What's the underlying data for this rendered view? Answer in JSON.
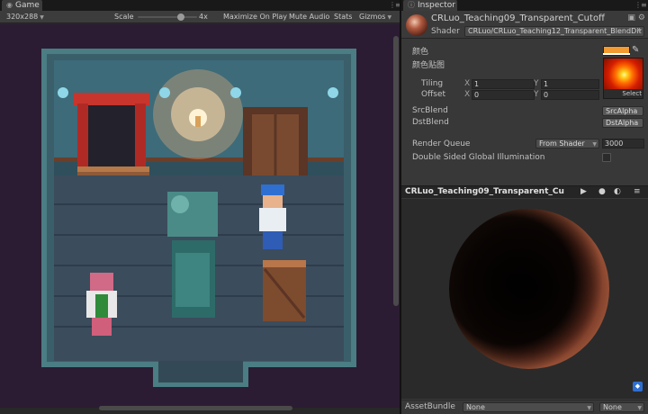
{
  "game": {
    "tab_label": "Game",
    "resolution": "320x288",
    "scale_label": "Scale",
    "scale_value": "4x",
    "scale_slider_fraction": 0.72,
    "maximize_label": "Maximize On Play",
    "mute_label": "Mute Audio",
    "stats_label": "Stats",
    "gizmos_label": "Gizmos"
  },
  "inspector": {
    "tab_label": "Inspector",
    "material_name": "CRLuo_Teaching09_Transparent_Cutoff",
    "shader_label": "Shader",
    "shader_value": "CRLuo/CRLuo_Teaching12_Transparent_BlendDit",
    "color_label": "颜色",
    "texture_label": "颜色贴图",
    "tiling_label": "Tiling",
    "offset_label": "Offset",
    "tiling_x": "1",
    "tiling_y": "1",
    "offset_x": "0",
    "offset_y": "0",
    "x_axis": "X",
    "y_axis": "Y",
    "select_label": "Select",
    "src_blend_label": "SrcBlend",
    "src_blend_value": "SrcAlpha",
    "dst_blend_label": "DstBlend",
    "dst_blend_value": "DstAlpha",
    "render_queue_label": "Render Queue",
    "render_queue_mode": "From Shader",
    "render_queue_value": "3000",
    "double_sided_label": "Double Sided Global Illumination",
    "double_sided_checked": false,
    "color_value": "#f39a30",
    "preview_title": "CRLuo_Teaching09_Transparent_Cu",
    "asset_bundle_label": "AssetBundle",
    "asset_bundle_value": "None",
    "asset_variant_value": "None"
  },
  "colors": {
    "accent": "#2f6fd1",
    "panel": "#383838",
    "toolbar": "#3c3c3c"
  }
}
